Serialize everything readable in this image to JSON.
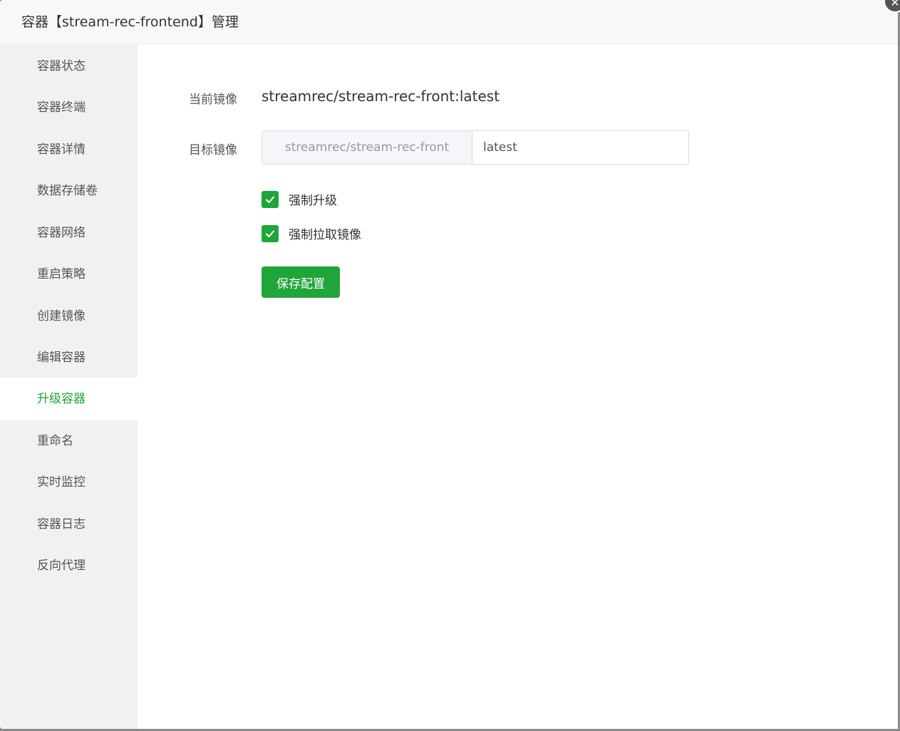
{
  "dialog": {
    "title": "容器【stream-rec-frontend】管理",
    "close_icon": "close-icon"
  },
  "sidebar": {
    "items": [
      {
        "label": "容器状态",
        "active": false
      },
      {
        "label": "容器终端",
        "active": false
      },
      {
        "label": "容器详情",
        "active": false
      },
      {
        "label": "数据存储卷",
        "active": false
      },
      {
        "label": "容器网络",
        "active": false
      },
      {
        "label": "重启策略",
        "active": false
      },
      {
        "label": "创建镜像",
        "active": false
      },
      {
        "label": "编辑容器",
        "active": false
      },
      {
        "label": "升级容器",
        "active": true
      },
      {
        "label": "重命名",
        "active": false
      },
      {
        "label": "实时监控",
        "active": false
      },
      {
        "label": "容器日志",
        "active": false
      },
      {
        "label": "反向代理",
        "active": false
      }
    ]
  },
  "form": {
    "current_image_label": "当前镜像",
    "current_image_value": "streamrec/stream-rec-front:latest",
    "target_image_label": "目标镜像",
    "target_image_prefix": "streamrec/stream-rec-front",
    "target_image_tag": "latest",
    "force_upgrade_label": "强制升级",
    "force_upgrade_checked": true,
    "force_pull_label": "强制拉取镜像",
    "force_pull_checked": true,
    "save_label": "保存配置"
  },
  "colors": {
    "accent": "#20a53a",
    "sidebar_bg": "#f1f1f1",
    "header_bg": "#f8f8f8"
  }
}
